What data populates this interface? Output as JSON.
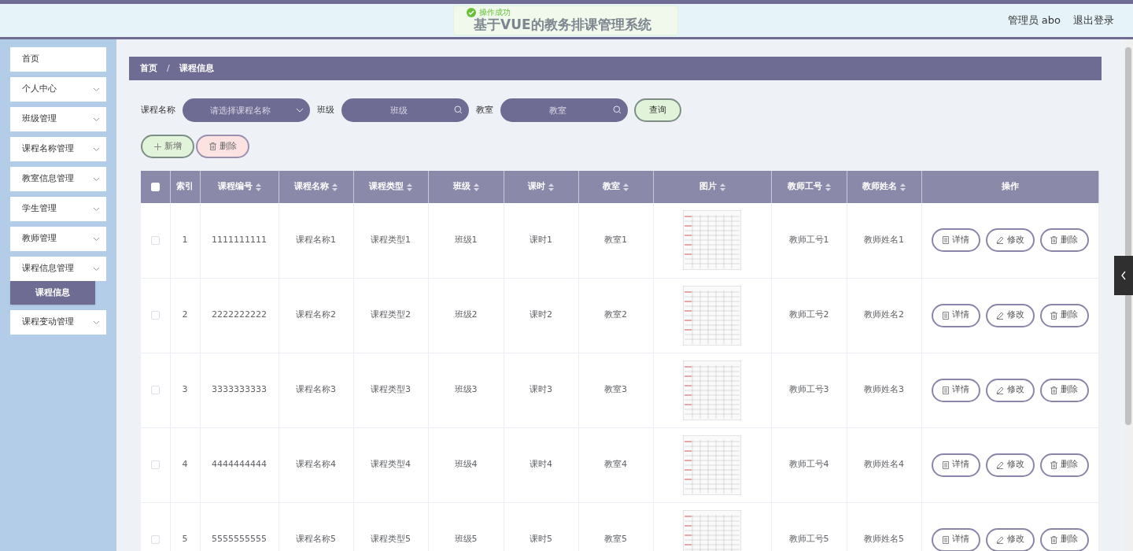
{
  "header": {
    "title": "基于VUE的教务排课管理系统",
    "user": "管理员 abo",
    "logout": "退出登录"
  },
  "toast": {
    "message": "操作成功"
  },
  "sidebar": {
    "items": [
      {
        "kind": "link",
        "label": "首页"
      },
      {
        "kind": "submenu",
        "label": "个人中心"
      },
      {
        "kind": "submenu",
        "label": "班级管理"
      },
      {
        "kind": "submenu",
        "label": "课程名称管理"
      },
      {
        "kind": "submenu",
        "label": "教室信息管理"
      },
      {
        "kind": "submenu",
        "label": "学生管理"
      },
      {
        "kind": "submenu",
        "label": "教师管理"
      },
      {
        "kind": "submenu",
        "label": "课程信息管理",
        "children": [
          {
            "label": "课程信息",
            "selected": true
          }
        ]
      },
      {
        "kind": "submenu",
        "label": "课程变动管理"
      }
    ]
  },
  "breadcrumb": {
    "items": [
      "首页",
      "课程信息"
    ],
    "separator": "/"
  },
  "search": {
    "fields": [
      {
        "kind": "select",
        "label": "课程名称",
        "placeholder": "请选择课程名称"
      },
      {
        "kind": "text",
        "label": "班级",
        "placeholder": "班级"
      },
      {
        "kind": "text",
        "label": "教室",
        "placeholder": "教室"
      }
    ],
    "button": "查询"
  },
  "actions": [
    {
      "kind": "add",
      "label": "新增"
    },
    {
      "kind": "delete",
      "label": "删除"
    }
  ],
  "table": {
    "select_all": {
      "checked": false
    },
    "columns": [
      {
        "kind": "text",
        "label": "索引",
        "sortable": false
      },
      {
        "kind": "text",
        "label": "课程编号",
        "sortable": true
      },
      {
        "kind": "text",
        "label": "课程名称",
        "sortable": true
      },
      {
        "kind": "text",
        "label": "课程类型",
        "sortable": true
      },
      {
        "kind": "text",
        "label": "班级",
        "sortable": true
      },
      {
        "kind": "text",
        "label": "课时",
        "sortable": true
      },
      {
        "kind": "text",
        "label": "教室",
        "sortable": true
      },
      {
        "kind": "image",
        "label": "图片",
        "sortable": true
      },
      {
        "kind": "text",
        "label": "教师工号",
        "sortable": true
      },
      {
        "kind": "text",
        "label": "教师姓名",
        "sortable": true
      },
      {
        "kind": "actions",
        "label": "操作",
        "sortable": false
      }
    ],
    "rows": [
      {
        "checked": false,
        "cells": [
          "1",
          "1111111111",
          "课程名称1",
          "课程类型1",
          "班级1",
          "课时1",
          "教室1",
          "",
          "教师工号1",
          "教师姓名1"
        ],
        "actions": [
          {
            "kind": "detail",
            "label": "详情"
          },
          {
            "kind": "edit",
            "label": "修改"
          },
          {
            "kind": "delete",
            "label": "删除"
          }
        ]
      },
      {
        "checked": false,
        "cells": [
          "2",
          "2222222222",
          "课程名称2",
          "课程类型2",
          "班级2",
          "课时2",
          "教室2",
          "",
          "教师工号2",
          "教师姓名2"
        ],
        "actions": [
          {
            "kind": "detail",
            "label": "详情"
          },
          {
            "kind": "edit",
            "label": "修改"
          },
          {
            "kind": "delete",
            "label": "删除"
          }
        ]
      },
      {
        "checked": false,
        "cells": [
          "3",
          "3333333333",
          "课程名称3",
          "课程类型3",
          "班级3",
          "课时3",
          "教室3",
          "",
          "教师工号3",
          "教师姓名3"
        ],
        "actions": [
          {
            "kind": "detail",
            "label": "详情"
          },
          {
            "kind": "edit",
            "label": "修改"
          },
          {
            "kind": "delete",
            "label": "删除"
          }
        ]
      },
      {
        "checked": false,
        "cells": [
          "4",
          "4444444444",
          "课程名称4",
          "课程类型4",
          "班级4",
          "课时4",
          "教室4",
          "",
          "教师工号4",
          "教师姓名4"
        ],
        "actions": [
          {
            "kind": "detail",
            "label": "详情"
          },
          {
            "kind": "edit",
            "label": "修改"
          },
          {
            "kind": "delete",
            "label": "删除"
          }
        ]
      },
      {
        "checked": false,
        "cells": [
          "5",
          "5555555555",
          "课程名称5",
          "课程类型5",
          "班级5",
          "课时5",
          "教室5",
          "",
          "教师工号5",
          "教师姓名5"
        ],
        "actions": [
          {
            "kind": "detail",
            "label": "详情"
          },
          {
            "kind": "edit",
            "label": "修改"
          },
          {
            "kind": "delete",
            "label": "删除"
          }
        ]
      }
    ]
  }
}
